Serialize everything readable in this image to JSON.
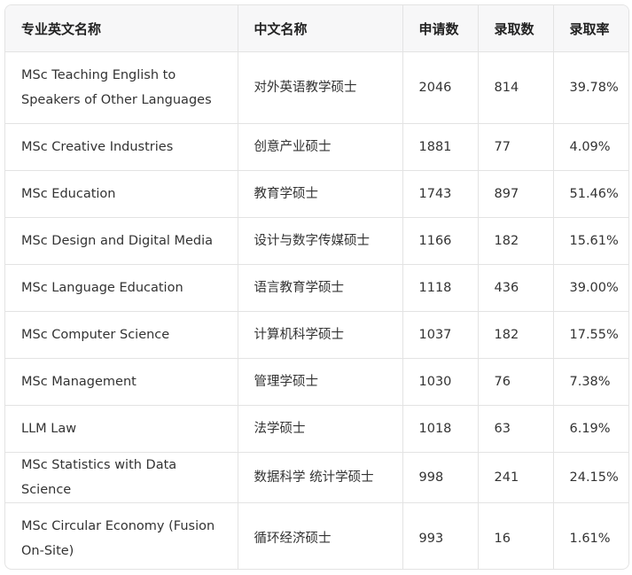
{
  "table": {
    "headers": [
      "专业英文名称",
      "中文名称",
      "申请数",
      "录取数",
      "录取率"
    ],
    "rows": [
      [
        "MSc Teaching English to Speakers of Other Languages",
        "对外英语教学硕士",
        "2046",
        "814",
        "39.78%"
      ],
      [
        "MSc Creative Industries",
        "创意产业硕士",
        "1881",
        "77",
        "4.09%"
      ],
      [
        "MSc Education",
        "教育学硕士",
        "1743",
        "897",
        "51.46%"
      ],
      [
        "MSc Design and Digital Media",
        "设计与数字传媒硕士",
        "1166",
        "182",
        "15.61%"
      ],
      [
        "MSc Language Education",
        "语言教育学硕士",
        "1118",
        "436",
        "39.00%"
      ],
      [
        "MSc Computer Science",
        "计算机科学硕士",
        "1037",
        "182",
        "17.55%"
      ],
      [
        "MSc Management",
        "管理学硕士",
        "1030",
        "76",
        "7.38%"
      ],
      [
        "LLM Law",
        "法学硕士",
        "1018",
        "63",
        "6.19%"
      ],
      [
        "MSc Statistics with Data Science",
        "数据科学 统计学硕士",
        "998",
        "241",
        "24.15%"
      ],
      [
        "MSc Circular Economy (Fusion On-Site)",
        "循环经济硕士",
        "993",
        "16",
        "1.61%"
      ]
    ]
  }
}
